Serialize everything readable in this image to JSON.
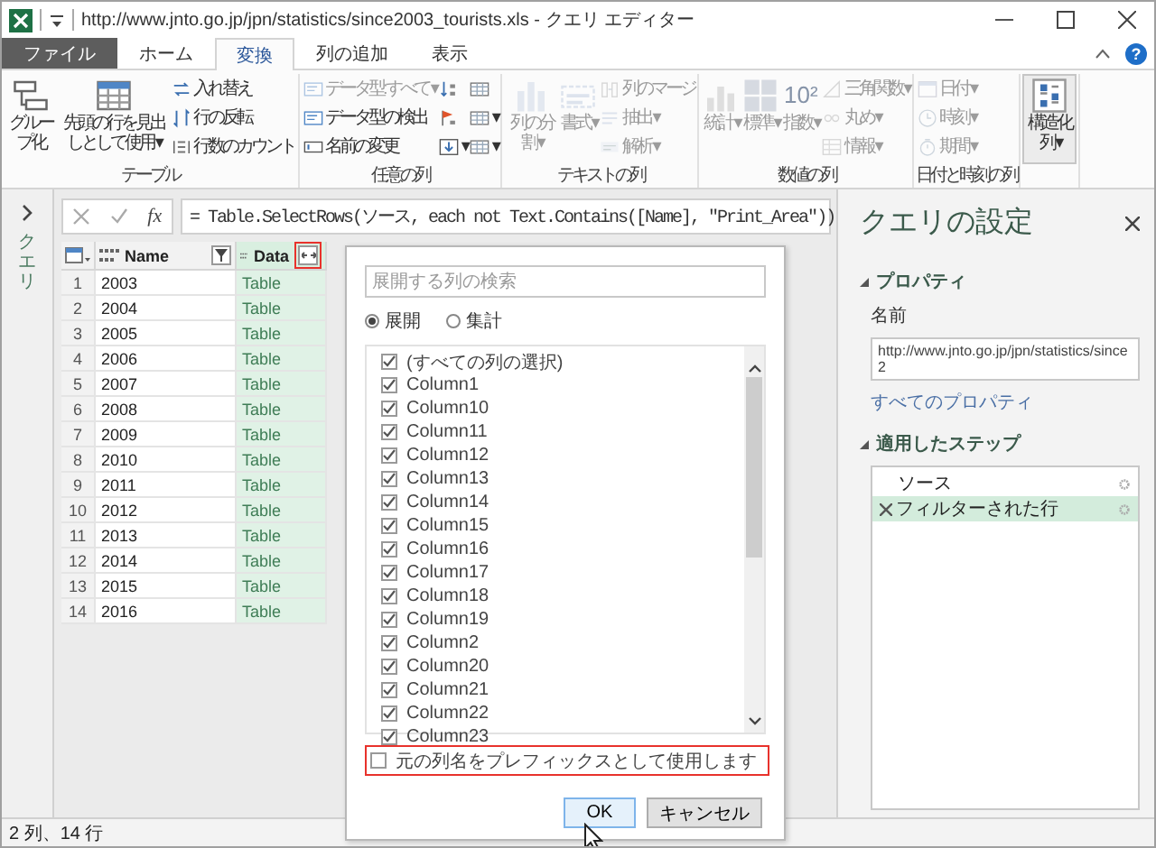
{
  "window": {
    "title": "http://www.jnto.go.jp/jpn/statistics/since2003_tourists.xls - クエリ エディター"
  },
  "menu_tabs": [
    {
      "label": "ファイル",
      "kind": "file",
      "selected": false
    },
    {
      "label": "ホーム",
      "kind": "tab",
      "selected": false
    },
    {
      "label": "変換",
      "kind": "tab",
      "selected": true
    },
    {
      "label": "列の追加",
      "kind": "tab",
      "selected": false
    },
    {
      "label": "表示",
      "kind": "tab",
      "selected": false
    }
  ],
  "help_button": "?",
  "ribbon_groups": [
    {
      "label": "テーブル",
      "boxed": false,
      "stacks": [
        {
          "kind": "large",
          "buttons": [
            {
              "label": "グループ化",
              "disabled": false
            }
          ]
        },
        {
          "kind": "large",
          "buttons": [
            {
              "label": "先頭の行を見出しとして使用 ▾",
              "disabled": false
            }
          ]
        },
        {
          "kind": "small",
          "buttons": [
            {
              "label": "入れ替え",
              "disabled": false
            },
            {
              "label": "行の反転",
              "disabled": false
            },
            {
              "label": "行数のカウント",
              "disabled": false
            }
          ]
        }
      ]
    },
    {
      "label": "任意の列",
      "boxed": false,
      "stacks": [
        {
          "kind": "small",
          "buttons": [
            {
              "label": "データ型: すべて ▾",
              "disabled": true
            },
            {
              "label": "データ型の検出",
              "disabled": false
            },
            {
              "label": "名前の変更",
              "disabled": false
            }
          ]
        },
        {
          "kind": "icons",
          "buttons": [
            {
              "disabled": false
            },
            {
              "disabled": false
            },
            {
              "label": "▾",
              "disabled": false
            }
          ]
        },
        {
          "kind": "icons",
          "buttons": [
            {
              "disabled": false
            },
            {
              "label": "▾",
              "disabled": false
            },
            {
              "label": "▾",
              "disabled": false
            }
          ]
        }
      ]
    },
    {
      "label": "テキストの列",
      "boxed": false,
      "stacks": [
        {
          "kind": "large",
          "buttons": [
            {
              "label": "列の分割 ▾",
              "disabled": true
            }
          ]
        },
        {
          "kind": "large",
          "buttons": [
            {
              "label": "書式 ▾",
              "disabled": true
            }
          ]
        },
        {
          "kind": "small",
          "buttons": [
            {
              "label": "列のマージ",
              "disabled": true
            },
            {
              "label": "抽出 ▾",
              "disabled": true
            },
            {
              "label": "解析 ▾",
              "disabled": true
            }
          ]
        }
      ]
    },
    {
      "label": "数値の列",
      "boxed": false,
      "stacks": [
        {
          "kind": "large",
          "buttons": [
            {
              "label": "統計 ▾",
              "disabled": true
            }
          ]
        },
        {
          "kind": "large",
          "buttons": [
            {
              "label": "標準 ▾",
              "disabled": true
            }
          ]
        },
        {
          "kind": "large",
          "buttons": [
            {
              "label": "指数 ▾",
              "glyph": "10²",
              "disabled": true
            }
          ]
        },
        {
          "kind": "small",
          "buttons": [
            {
              "label": "三角関数 ▾",
              "disabled": true
            },
            {
              "label": "丸め ▾",
              "disabled": true
            },
            {
              "label": "情報 ▾",
              "disabled": true
            }
          ]
        }
      ]
    },
    {
      "label": "日付と時刻の列",
      "boxed": false,
      "stacks": [
        {
          "kind": "small",
          "buttons": [
            {
              "label": "日付 ▾",
              "disabled": true
            },
            {
              "label": "時刻 ▾",
              "disabled": true
            },
            {
              "label": "期間 ▾",
              "disabled": true
            }
          ]
        }
      ]
    },
    {
      "boxed": true,
      "stacks": [
        {
          "kind": "large",
          "buttons": [
            {
              "label": "構造化列 ▾",
              "disabled": false
            }
          ]
        }
      ]
    }
  ],
  "queries_pane": {
    "label": "クエリ"
  },
  "formula_bar": {
    "function_button": "fx",
    "formula": "= Table.SelectRows(ソース, each not Text.Contains([Name], \"Print_Area\"))"
  },
  "table": {
    "columns": [
      {
        "label": "Name",
        "kind": "filter",
        "highlighted": false
      },
      {
        "label": "Data",
        "kind": "expand",
        "highlighted": true
      }
    ],
    "rows": [
      {
        "index": "1",
        "name": "2003",
        "data": "Table"
      },
      {
        "index": "2",
        "name": "2004",
        "data": "Table"
      },
      {
        "index": "3",
        "name": "2005",
        "data": "Table"
      },
      {
        "index": "4",
        "name": "2006",
        "data": "Table"
      },
      {
        "index": "5",
        "name": "2007",
        "data": "Table"
      },
      {
        "index": "6",
        "name": "2008",
        "data": "Table"
      },
      {
        "index": "7",
        "name": "2009",
        "data": "Table"
      },
      {
        "index": "8",
        "name": "2010",
        "data": "Table"
      },
      {
        "index": "9",
        "name": "2011",
        "data": "Table"
      },
      {
        "index": "10",
        "name": "2012",
        "data": "Table"
      },
      {
        "index": "11",
        "name": "2013",
        "data": "Table"
      },
      {
        "index": "12",
        "name": "2014",
        "data": "Table"
      },
      {
        "index": "13",
        "name": "2015",
        "data": "Table"
      },
      {
        "index": "14",
        "name": "2016",
        "data": "Table"
      }
    ]
  },
  "expand_dialog": {
    "search": {
      "placeholder": "展開する列の検索"
    },
    "modes": [
      {
        "label": "展開",
        "selected": true
      },
      {
        "label": "集計",
        "selected": false
      }
    ],
    "columns": [
      {
        "label": "(すべての列の選択)",
        "checked": true
      },
      {
        "label": "Column1",
        "checked": true
      },
      {
        "label": "Column10",
        "checked": true
      },
      {
        "label": "Column11",
        "checked": true
      },
      {
        "label": "Column12",
        "checked": true
      },
      {
        "label": "Column13",
        "checked": true
      },
      {
        "label": "Column14",
        "checked": true
      },
      {
        "label": "Column15",
        "checked": true
      },
      {
        "label": "Column16",
        "checked": true
      },
      {
        "label": "Column17",
        "checked": true
      },
      {
        "label": "Column18",
        "checked": true
      },
      {
        "label": "Column19",
        "checked": true
      },
      {
        "label": "Column2",
        "checked": true
      },
      {
        "label": "Column20",
        "checked": true
      },
      {
        "label": "Column21",
        "checked": true
      },
      {
        "label": "Column22",
        "checked": true
      },
      {
        "label": "Column23",
        "checked": true
      }
    ],
    "prefix_option": {
      "label": "元の列名をプレフィックスとして使用します",
      "checked": false,
      "highlighted": true
    },
    "buttons": [
      {
        "label": "OK",
        "kind": "default"
      },
      {
        "label": "キャンセル",
        "kind": "normal"
      }
    ]
  },
  "query_settings": {
    "title": "クエリの設定",
    "properties": {
      "heading": "プロパティ",
      "expanded": true,
      "name_label": "名前",
      "name_value": "http://www.jnto.go.jp/jpn/statistics/since2",
      "all_link": "すべてのプロパティ"
    },
    "steps": {
      "heading": "適用したステップ",
      "expanded": true,
      "items": [
        {
          "label": "ソース",
          "selected": false
        },
        {
          "label": "フィルターされた行",
          "selected": true
        }
      ]
    }
  },
  "status_bar": {
    "text": "2 列、14 行"
  }
}
